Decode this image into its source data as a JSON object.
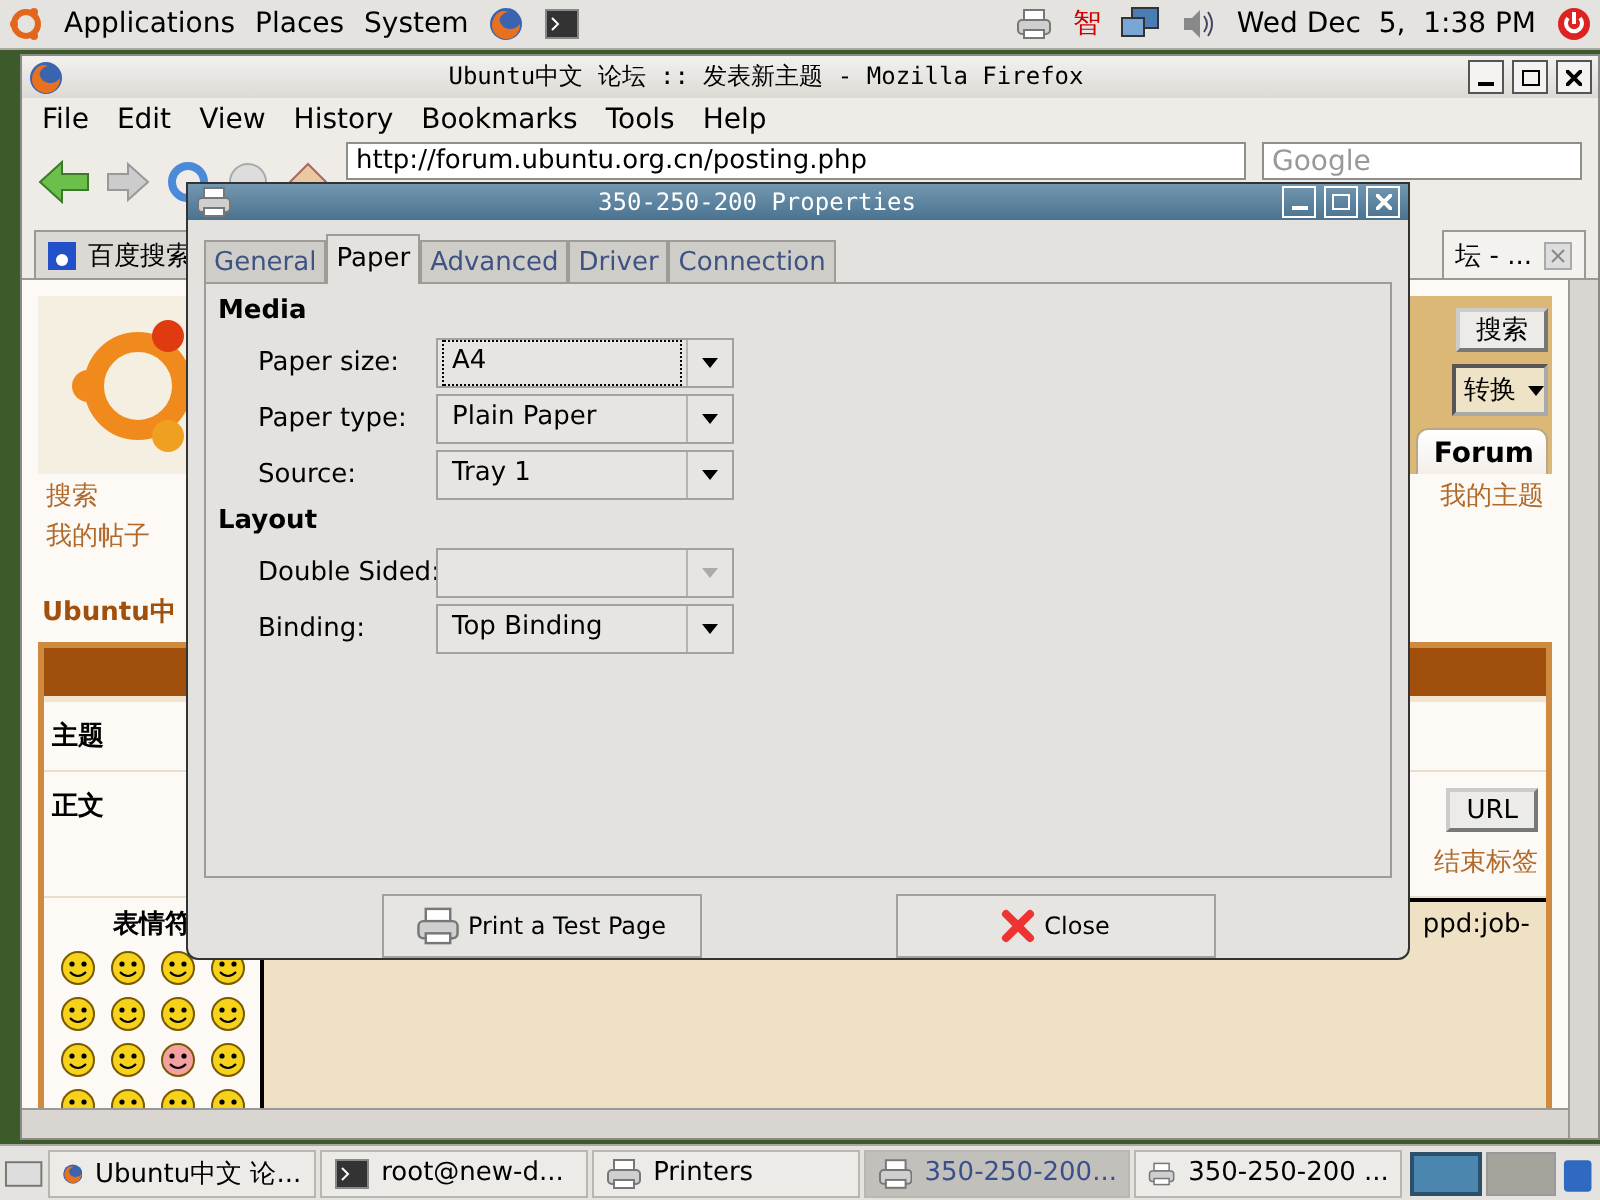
{
  "top_panel": {
    "menus": [
      "Applications",
      "Places",
      "System"
    ],
    "tray_text": "智",
    "clock": "Wed Dec  5,  1:38 PM"
  },
  "browser": {
    "title": "Ubuntu中文 论坛 :: 发表新主题 - Mozilla Firefox",
    "menu": [
      "File",
      "Edit",
      "View",
      "History",
      "Bookmarks",
      "Tools",
      "Help"
    ],
    "url": "http://forum.ubuntu.org.cn/posting.php",
    "search_placeholder": "Google",
    "tabs": [
      {
        "label": "百度搜索",
        "selected": false
      },
      {
        "label": "坛 - ...",
        "selected": true
      }
    ]
  },
  "page": {
    "search_button": "搜索",
    "encoding_select": "转换",
    "forum_tab": "Forum",
    "links_left": [
      "搜索",
      "我的帖子"
    ],
    "links_right": [
      "我的主题"
    ],
    "section_title": "Ubuntu中",
    "rows": [
      "主题",
      "正文"
    ],
    "smilies_heading": "表情符",
    "url_button": "URL",
    "close_tags_link": "结束标签",
    "message_text": "ppd:job-"
  },
  "dialog": {
    "title": "350-250-200 Properties",
    "tabs": [
      {
        "label": "General",
        "selected": false
      },
      {
        "label": "Paper",
        "selected": true
      },
      {
        "label": "Advanced",
        "selected": false
      },
      {
        "label": "Driver",
        "selected": false
      },
      {
        "label": "Connection",
        "selected": false
      }
    ],
    "sections": [
      {
        "heading": "Media",
        "fields": [
          {
            "label": "Paper size:",
            "value": "A4",
            "focused": true,
            "disabled": false
          },
          {
            "label": "Paper type:",
            "value": "Plain Paper",
            "focused": false,
            "disabled": false
          },
          {
            "label": "Source:",
            "value": "Tray 1",
            "focused": false,
            "disabled": false
          }
        ]
      },
      {
        "heading": "Layout",
        "fields": [
          {
            "label": "Double Sided:",
            "focused": false,
            "disabled": true
          },
          {
            "label": "Binding:",
            "value": "Top Binding",
            "focused": false,
            "disabled": false
          }
        ]
      }
    ],
    "buttons": [
      {
        "label": "Print a Test Page",
        "kind": "print"
      },
      {
        "label": "Close",
        "kind": "close"
      }
    ]
  },
  "taskbar": {
    "items": [
      {
        "label": "Ubuntu中文 论...",
        "kind": "browser",
        "selected": false
      },
      {
        "label": "root@new-d...",
        "kind": "terminal",
        "selected": false
      },
      {
        "label": "Printers",
        "kind": "printer",
        "selected": false
      },
      {
        "label": "350-250-200...",
        "kind": "printer",
        "selected": true
      },
      {
        "label": "350-250-200 ...",
        "kind": "printer",
        "selected": false
      }
    ],
    "workspaces": [
      {
        "selected": true
      },
      {
        "selected": false
      }
    ]
  }
}
